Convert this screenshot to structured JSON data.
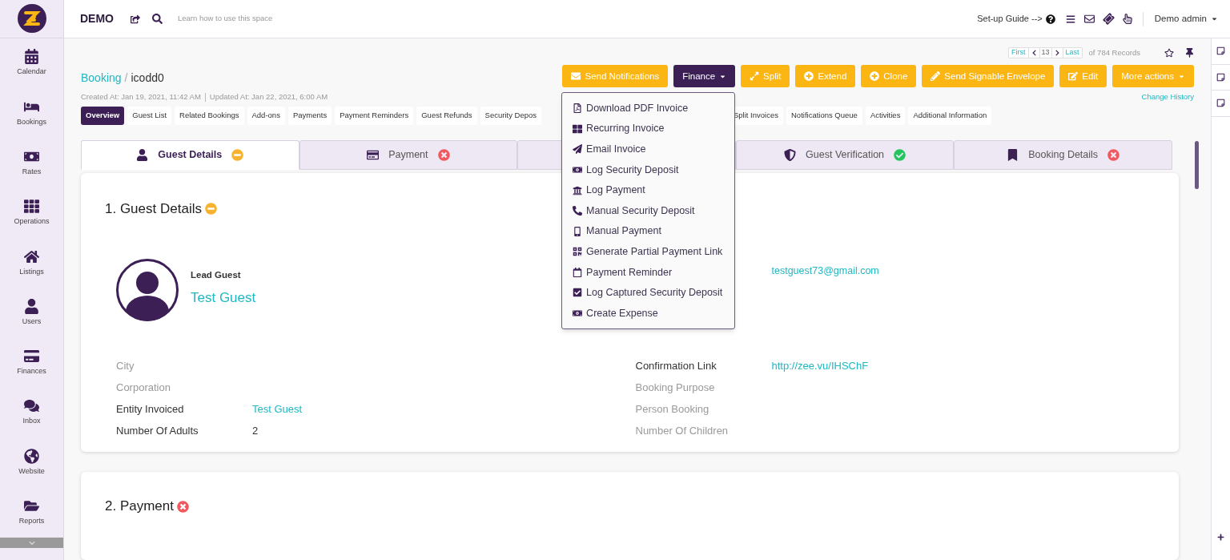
{
  "topbar": {
    "space": "DEMO",
    "hint": "Learn how to use this space",
    "guide": "Set-up Guide -->",
    "user": "Demo admin"
  },
  "sidebar": {
    "items": [
      {
        "label": "Calendar"
      },
      {
        "label": "Bookings"
      },
      {
        "label": "Rates"
      },
      {
        "label": "Operations"
      },
      {
        "label": "Listings"
      },
      {
        "label": "Users"
      },
      {
        "label": "Finances"
      },
      {
        "label": "Inbox"
      },
      {
        "label": "Website"
      },
      {
        "label": "Reports"
      }
    ]
  },
  "pager": {
    "first": "First",
    "current": "13",
    "last": "Last",
    "total": "of 784 Records"
  },
  "breadcrumb": {
    "parent": "Booking",
    "separator": "/",
    "current": "icodd0"
  },
  "meta": {
    "created": "Created At: Jan 19, 2021, 11:42 AM",
    "updated": "Updated At: Jan 22, 2021, 6:00 AM",
    "history": "Change History"
  },
  "actions": [
    {
      "label": "Send Notifications",
      "kind": "accent",
      "caret": false
    },
    {
      "label": "Finance",
      "kind": "dark",
      "caret": true,
      "open": true,
      "menu": [
        "Download PDF Invoice",
        "Recurring Invoice",
        "Email Invoice",
        "Log Security Deposit",
        "Log Payment",
        "Manual Security Deposit",
        "Manual Payment",
        "Generate Partial Payment Link",
        "Payment Reminder",
        "Log Captured Security Deposit",
        "Create Expense"
      ]
    },
    {
      "label": "Split",
      "kind": "accent",
      "caret": false
    },
    {
      "label": "Extend",
      "kind": "accent",
      "caret": false
    },
    {
      "label": "Clone",
      "kind": "accent",
      "caret": false
    },
    {
      "label": "Send Signable Envelope",
      "kind": "accent",
      "caret": false
    },
    {
      "label": "Edit",
      "kind": "accent",
      "caret": false
    },
    {
      "label": "More actions",
      "kind": "accent",
      "caret": true
    }
  ],
  "tabs": [
    {
      "label": "Overview",
      "selected": true
    },
    {
      "label": "Guest List",
      "selected": false
    },
    {
      "label": "Related Bookings",
      "selected": false
    },
    {
      "label": "Add-ons",
      "selected": false
    },
    {
      "label": "Payments",
      "selected": false
    },
    {
      "label": "Payment Reminders",
      "selected": false
    },
    {
      "label": "Guest Refunds",
      "selected": false
    },
    {
      "label": "Security Depos",
      "selected": false
    },
    {
      "label": "Split Invoices",
      "selected": false
    },
    {
      "label": "Notifications Queue",
      "selected": false
    },
    {
      "label": "Activities",
      "selected": false
    },
    {
      "label": "Additional Information",
      "selected": false
    }
  ],
  "sections": [
    {
      "label": "Guest Details",
      "kind": "pending",
      "selected": true
    },
    {
      "label": "Payment",
      "kind": "error",
      "selected": false
    },
    {
      "selected": false
    },
    {
      "label": "Guest Verification",
      "kind": "ok",
      "selected": false
    },
    {
      "label": "Booking Details",
      "kind": "error",
      "selected": false
    }
  ],
  "guest_card": {
    "title": "1. Guest Details",
    "kind": "pending",
    "role": "Lead Guest",
    "name": "Test Guest",
    "email": "testguest73@gmail.com",
    "left_fields": [
      {
        "label": "City"
      },
      {
        "label": "Corporation"
      },
      {
        "label": "Entity Invoiced",
        "value": "Test Guest"
      },
      {
        "label": "Number Of Adults",
        "value": "2"
      }
    ],
    "right_fields": [
      {
        "label": "Confirmation Link",
        "value": "http://zee.vu/IHSChF"
      },
      {
        "label": "Booking Purpose"
      },
      {
        "label": "Person Booking"
      },
      {
        "label": "Number Of Children"
      }
    ]
  },
  "payment_card": {
    "title": "2. Payment",
    "kind": "error"
  }
}
